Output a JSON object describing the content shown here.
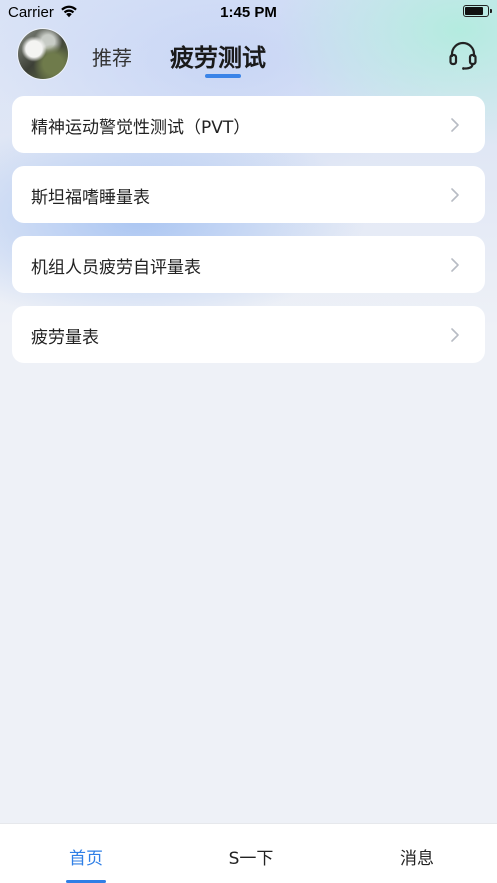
{
  "status_bar": {
    "carrier": "Carrier",
    "time": "1:45 PM",
    "battery_level": 0.85
  },
  "header": {
    "tabs": [
      {
        "label": "推荐",
        "active": false
      },
      {
        "label": "疲劳测试",
        "active": true
      }
    ],
    "support_icon": "headset-icon",
    "accent_color": "#3a84e8"
  },
  "list": {
    "items": [
      {
        "label": "精神运动警觉性测试（PVT）"
      },
      {
        "label": "斯坦福嗜睡量表"
      },
      {
        "label": "机组人员疲劳自评量表"
      },
      {
        "label": "疲劳量表"
      }
    ]
  },
  "tabbar": {
    "items": [
      {
        "label": "首页",
        "active": true
      },
      {
        "label": "S一下",
        "active": false
      },
      {
        "label": "消息",
        "active": false
      }
    ],
    "active_color": "#2f7fe6"
  }
}
